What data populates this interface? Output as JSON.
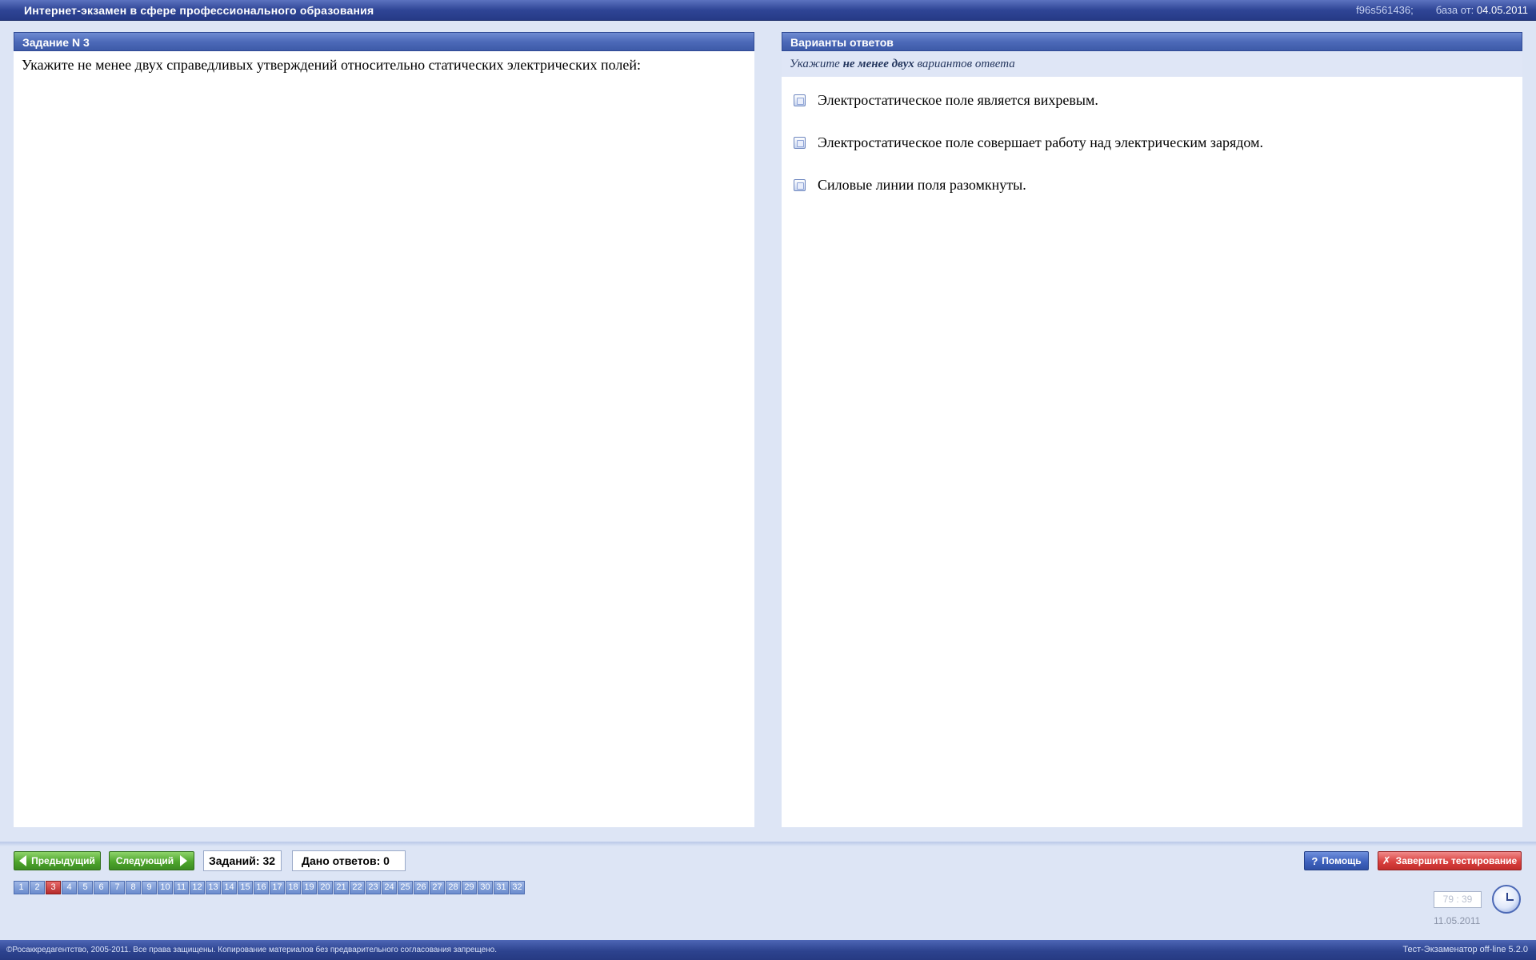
{
  "app": {
    "title": "Интернет-экзамен в сфере профессионального образования",
    "session_id": "f96s561436;",
    "base_label": "база от:",
    "base_date": "04.05.2011"
  },
  "task": {
    "header": "Задание N 3",
    "question": "Укажите не менее двух справедливых утверждений относительно статических электрических полей:"
  },
  "answers_panel": {
    "header": "Варианты ответов",
    "instruction_pre": "Укажите",
    "instruction_bold": "не менее двух",
    "instruction_post": "вариантов ответа",
    "options": [
      {
        "label": "Электростатическое поле является вихревым.",
        "checked": false
      },
      {
        "label": "Электростатическое поле совершает работу над электрическим зарядом.",
        "checked": false
      },
      {
        "label": "Силовые линии поля разомкнуты.",
        "checked": false
      }
    ]
  },
  "nav": {
    "prev_label": "Предыдущий",
    "next_label": "Следующий",
    "tasks_count": "Заданий: 32",
    "answers_given": "Дано ответов: 0",
    "help_label": "Помощь",
    "finish_label": "Завершить тестирование"
  },
  "pages": {
    "items": [
      "1",
      "2",
      "3",
      "4",
      "5",
      "6",
      "7",
      "8",
      "9",
      "10",
      "11",
      "12",
      "13",
      "14",
      "15",
      "16",
      "17",
      "18",
      "19",
      "20",
      "21",
      "22",
      "23",
      "24",
      "25",
      "26",
      "27",
      "28",
      "29",
      "30",
      "31",
      "32"
    ],
    "current": "3"
  },
  "timer": {
    "value": "79 : 39",
    "date": "11.05.2011"
  },
  "footer": {
    "copyright": "©Росаккредагентство, 2005-2011. Все права защищены. Копирование материалов без предварительного согласования запрещено.",
    "version": "Тест-Экзаменатор off-line 5.2.0"
  },
  "colors": {
    "accent": "#3d5aa8",
    "current_page": "#b52a2a",
    "next_prev": "#4ea52d",
    "finish": "#d9413f"
  }
}
